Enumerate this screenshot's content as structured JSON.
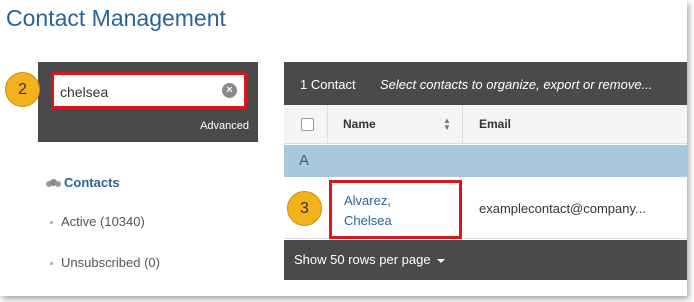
{
  "page": {
    "title": "Contact Management"
  },
  "search": {
    "value": "chelsea",
    "advanced_label": "Advanced"
  },
  "badges": {
    "step2": "2",
    "step3": "3"
  },
  "nav": {
    "contacts_label": "Contacts",
    "items": [
      {
        "label": "Active (10340)"
      },
      {
        "label": "Unsubscribed (0)"
      }
    ]
  },
  "table": {
    "count_label": "1 Contact",
    "hint": "Select contacts to organize, export or remove...",
    "columns": {
      "name": "Name",
      "email": "Email"
    },
    "group_letter": "A",
    "rows": [
      {
        "name_line1": "Alvarez,",
        "name_line2": "Chelsea",
        "email": "examplecontact@company..."
      }
    ],
    "footer": "Show 50 rows per page"
  },
  "colors": {
    "accent": "#2a6496",
    "highlight": "#d9161c",
    "badge": "#f3b21c",
    "dark_bar": "#4a4a4a",
    "group_row": "#a9c8dc"
  }
}
